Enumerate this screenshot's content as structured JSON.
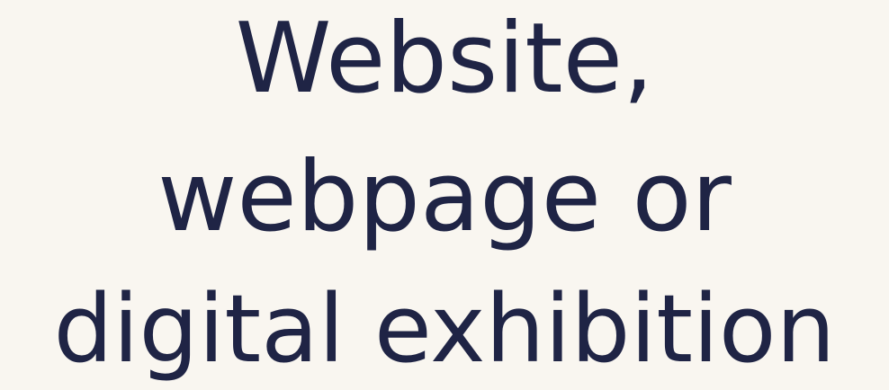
{
  "heading": {
    "line1": "Website,",
    "line2": "webpage or",
    "line3": "digital exhibition"
  },
  "colors": {
    "background": "#f9f6f0",
    "text": "#1f2445"
  }
}
